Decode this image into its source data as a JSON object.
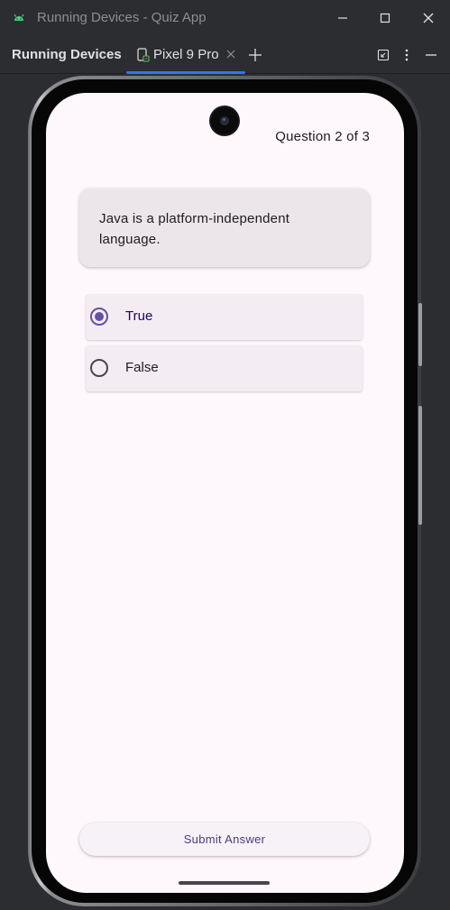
{
  "window": {
    "title": "Running Devices - Quiz App",
    "app_icon": "android-icon"
  },
  "toolbar": {
    "title": "Running Devices",
    "tab": {
      "label": "Pixel 9 Pro",
      "icon": "device-icon",
      "close_icon": "close-icon"
    },
    "actions": [
      "add-tab-icon",
      "collapse-icon",
      "more-options-icon",
      "minimize-icon"
    ]
  },
  "device": {
    "screen": {
      "progress": "Question 2 of 3",
      "question": "Java is a platform-independent language.",
      "options": [
        {
          "label": "True",
          "selected": true
        },
        {
          "label": "False",
          "selected": false
        }
      ],
      "submit_label": "Submit Answer"
    }
  },
  "colors": {
    "ide_background": "#2b2d30",
    "tab_underline": "#3574f0",
    "screen_background": "#fef7fb",
    "accent": "#6750a4"
  }
}
